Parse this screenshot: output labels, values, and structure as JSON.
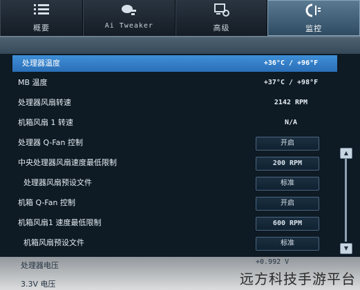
{
  "tabs": [
    {
      "label": "概要",
      "icon": "list-icon",
      "active": false
    },
    {
      "label": "Ai Tweaker",
      "icon": "tweaker-icon",
      "active": false
    },
    {
      "label": "高级",
      "icon": "advanced-icon",
      "active": false
    },
    {
      "label": "监控",
      "icon": "monitor-icon",
      "active": true
    }
  ],
  "rows": [
    {
      "name": "处理器温度",
      "value": "+36°C / +96°F",
      "type": "readout",
      "selected": true
    },
    {
      "name": "MB 温度",
      "value": "+37°C / +98°F",
      "type": "readout"
    },
    {
      "name": "处理器风扇转速",
      "value": "2142 RPM",
      "type": "readout"
    },
    {
      "name": "机箱风扇 1 转速",
      "value": "N/A",
      "type": "readout"
    },
    {
      "name": "处理器 Q-Fan 控制",
      "value": "开启",
      "type": "button"
    },
    {
      "name": "中央处理器风扇速度最低限制",
      "value": "200 RPM",
      "type": "button"
    },
    {
      "name": "处理器风扇预设文件",
      "value": "标准",
      "type": "button",
      "indent": true
    },
    {
      "name": "机箱 Q-Fan 控制",
      "value": "开启",
      "type": "button"
    },
    {
      "name": "机箱风扇1 速度最低限制",
      "value": "600 RPM",
      "type": "button"
    },
    {
      "name": "机箱风扇预设文件",
      "value": "标准",
      "type": "button",
      "indent": true
    }
  ],
  "faded_rows": [
    {
      "name": "处理器电压",
      "value": "+0.992 V"
    },
    {
      "name": "3.3V 电压",
      "value": ""
    }
  ],
  "scrollbar": {
    "up": "▲",
    "down": "▼"
  },
  "watermark": "远方科技手游平台",
  "colors": {
    "selected": "#3f8fd8",
    "background": "#0e1a24"
  }
}
